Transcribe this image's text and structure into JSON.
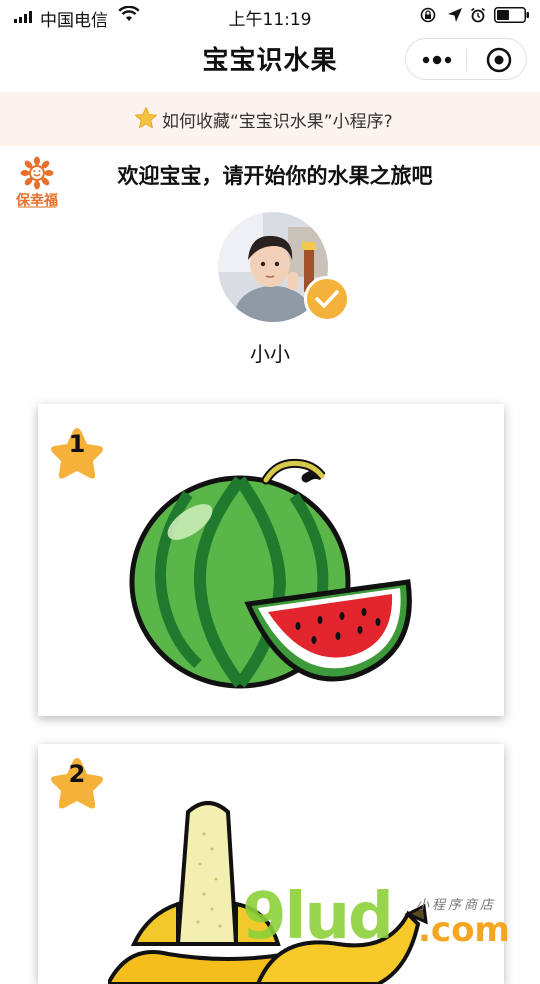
{
  "status_bar": {
    "carrier": "中国电信",
    "time": "上午11:19"
  },
  "nav": {
    "title": "宝宝识水果"
  },
  "banner": {
    "text": "如何收藏“宝宝识水果”小程序?"
  },
  "brand": {
    "name": "保幸福"
  },
  "welcome": {
    "text": "欢迎宝宝，请开始你的水果之旅吧"
  },
  "user": {
    "name": "小小"
  },
  "fruits": [
    {
      "number": "1",
      "image": "watermelon-illustration"
    },
    {
      "number": "2",
      "image": "banana-illustration"
    }
  ],
  "watermark": {
    "main": "9lud",
    "suffix": ".com",
    "sub": "小程序商店"
  },
  "colors": {
    "accent_star": "#f4b23c",
    "banner_bg": "#fdf3ee",
    "brand": "#e8702a"
  }
}
